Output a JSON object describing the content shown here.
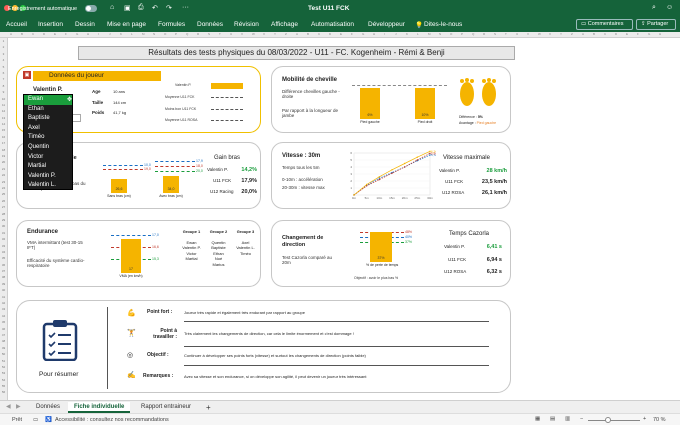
{
  "app": {
    "autosave": "Enregistrement automatique",
    "title": "Test U11 FCK",
    "search": "Rechercher (Cmd + Ctrl + U)"
  },
  "ribbon": {
    "tabs": [
      "Accueil",
      "Insertion",
      "Dessin",
      "Mise en page",
      "Formules",
      "Données",
      "Révision",
      "Affichage",
      "Automatisation",
      "Développeur",
      "Dites-le-nous"
    ],
    "comments": "Commentaires",
    "share": "Partager"
  },
  "sheet": {
    "title": "Résultats des tests physiques du 08/03/2022 - U11 - FC. Kogenheim - Rémi & Benji"
  },
  "player": {
    "header": "Données du joueur",
    "name": "Valentin P.",
    "fields": [
      {
        "label": "Age",
        "value": "10 ans"
      },
      {
        "label": "Taille",
        "value": "144 cm"
      },
      {
        "label": "Poids",
        "value": "41,7 kg"
      }
    ],
    "dropdown": [
      "Ewan",
      "Ethan",
      "Baptiste",
      "Axel",
      "Timéo",
      "Quentin",
      "Victor",
      "Martial",
      "Valentin P.",
      "Valentin L."
    ],
    "mini_chart": {
      "series": "Valentin P.",
      "lines": [
        "Moyenne U11 FCK",
        "Moins bon U11 FCK",
        "Moyenne U11 ROSA"
      ]
    }
  },
  "mobility": {
    "title": "Mobilité de cheville",
    "desc": [
      "Différence chevilles gauche - droite",
      "Par rapport à la longueur de jambe"
    ],
    "bars": [
      {
        "label": "Pied gauche",
        "value": "6%",
        "pct": 6
      },
      {
        "label": "Pied droit",
        "value": "10%",
        "pct": 10
      }
    ],
    "diff_label": "Différence :",
    "diff_value": "5%",
    "avg_label": "Avantage :",
    "avg_value": "Pied gauche"
  },
  "gain": {
    "title_partial": "ale",
    "desc": "Coordination haut-bas du corps",
    "title": "Gain bras",
    "lines": [
      "10,0",
      "17,9",
      "20,0"
    ],
    "bars": [
      {
        "label": "Sans bras (cm)",
        "value": "26,6"
      },
      {
        "label": "Avec bras (cm)",
        "value": "34,0"
      }
    ],
    "bars2": [
      "19,0",
      "18,0"
    ],
    "rows": [
      {
        "label": "Valentin P.",
        "value": "14,2%",
        "color": "#1a9d3c"
      },
      {
        "label": "U11 FCK",
        "value": "17,9%"
      },
      {
        "label": "U12 Racing",
        "value": "20,0%"
      }
    ]
  },
  "speed": {
    "title": "Vitesse : 30m",
    "desc": [
      "Temps tous les 5m",
      "0-10m : accélération",
      "20-30m : vitesse max"
    ],
    "chart_title": "Vitesse maximale",
    "y_ticks": [
      "6",
      "5",
      "4",
      "3",
      "2",
      "1"
    ],
    "x_ticks": [
      "0m",
      "5m",
      "10m",
      "15m",
      "20m",
      "25m",
      "30m"
    ],
    "end_values": [
      "5,72",
      "5,96",
      "6,24"
    ],
    "rows": [
      {
        "label": "Valentin P.",
        "value": "28 km/h",
        "color": "#1a9d3c"
      },
      {
        "label": "U11 FCK",
        "value": "23,5 km/h"
      },
      {
        "label": "U12 ROSA",
        "value": "26,1 km/h"
      }
    ]
  },
  "endurance": {
    "title": "Endurance",
    "desc": [
      "VMA intermittant (test 30-15 IFT)",
      "Efficacité du système cardio-respiratoire"
    ],
    "bar": {
      "value": "17",
      "label": "VMA (en km/h)"
    },
    "lines": [
      "17,0",
      "16,6",
      "15,3"
    ],
    "groups": [
      {
        "title": "Groupe 1",
        "members": [
          "Ewan",
          "Valentin P.",
          "Victor",
          "Martial"
        ]
      },
      {
        "title": "Groupe 2",
        "members": [
          "Quentin",
          "Baptiste",
          "Ethan",
          "Noé",
          "Marius"
        ]
      },
      {
        "title": "Groupe 3",
        "members": [
          "Axel",
          "Valentin L.",
          "Timéo"
        ]
      }
    ]
  },
  "cod": {
    "title": "Changement de direction",
    "desc": "Test Cazorla comparé au 20m",
    "bar": {
      "value": "37%",
      "label": "% de perte de temps"
    },
    "lines": [
      "48%",
      "40%",
      "37%"
    ],
    "note": "Objectif : avoir le plus bas %",
    "chart_title": "Temps Cazorla",
    "rows": [
      {
        "label": "Valentin P.",
        "value": "6,41 s",
        "color": "#1a9d3c"
      },
      {
        "label": "U11 FCK",
        "value": "6,94 s"
      },
      {
        "label": "U12 ROSA",
        "value": "6,32 s"
      }
    ]
  },
  "summary": {
    "label": "Pour résumer",
    "items": [
      {
        "k": "Point fort :",
        "v": "Joueur très rapide et également très endurant par rapport au groupe"
      },
      {
        "k": "Point à travailler :",
        "v": "Très clairement les changements de direction, car cela le limite énormement et c'est dommage !"
      },
      {
        "k": "Objectif :",
        "v": "Continuer à développer ses points forts (vitesse) et surtout les changements de direction (points faible)"
      },
      {
        "k": "Remarques :",
        "v": "Avec sa vitesse et son endurance, si on développe son agilité, il peut devenir un joueur très intéressant"
      }
    ]
  },
  "tabs": [
    "Données",
    "Fiche individuelle",
    "Rapport entraineur"
  ],
  "status": {
    "ready": "Prêt",
    "accessibility": "Accessibilité : consultez nos recommandations",
    "zoom": "70 %"
  },
  "colors": {
    "brand": "#15633a",
    "accent": "#f5b400",
    "good": "#1a9d3c"
  }
}
